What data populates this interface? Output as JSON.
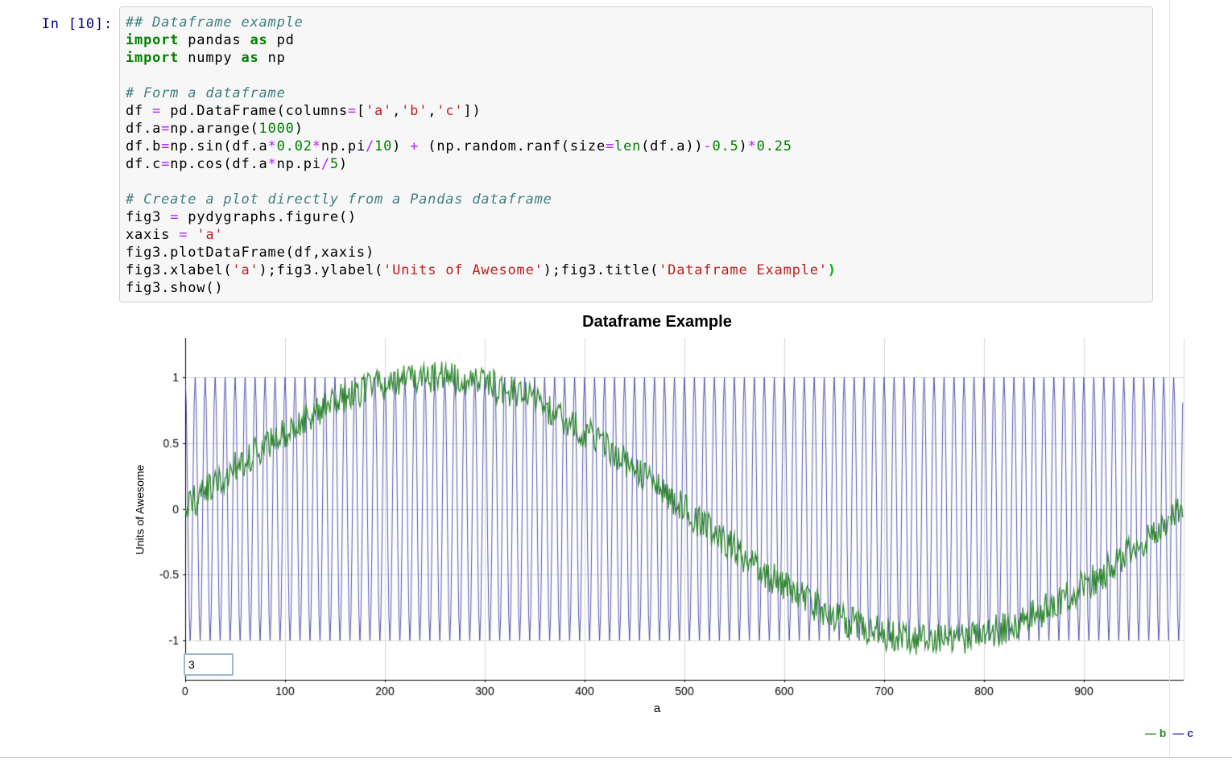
{
  "notebook": {
    "prompt": "In [10]:",
    "code_lines": [
      [
        [
          "c",
          "## Dataframe example"
        ]
      ],
      [
        [
          "k",
          "import"
        ],
        [
          "p",
          " pandas "
        ],
        [
          "k",
          "as"
        ],
        [
          "p",
          " pd"
        ]
      ],
      [
        [
          "k",
          "import"
        ],
        [
          "p",
          " numpy "
        ],
        [
          "k",
          "as"
        ],
        [
          "p",
          " np"
        ]
      ],
      [],
      [
        [
          "c",
          "# Form a dataframe"
        ]
      ],
      [
        [
          "p",
          "df "
        ],
        [
          "o",
          "="
        ],
        [
          "p",
          " pd.DataFrame(columns"
        ],
        [
          "o",
          "="
        ],
        [
          "p",
          "["
        ],
        [
          "s",
          "'a'"
        ],
        [
          "p",
          ","
        ],
        [
          "s",
          "'b'"
        ],
        [
          "p",
          ","
        ],
        [
          "s",
          "'c'"
        ],
        [
          "p",
          "])"
        ]
      ],
      [
        [
          "p",
          "df.a"
        ],
        [
          "o",
          "="
        ],
        [
          "p",
          "np.arange("
        ],
        [
          "n",
          "1000"
        ],
        [
          "p",
          ")"
        ]
      ],
      [
        [
          "p",
          "df.b"
        ],
        [
          "o",
          "="
        ],
        [
          "p",
          "np.sin(df.a"
        ],
        [
          "o",
          "*"
        ],
        [
          "n",
          "0.02"
        ],
        [
          "o",
          "*"
        ],
        [
          "p",
          "np.pi"
        ],
        [
          "o",
          "/"
        ],
        [
          "n",
          "10"
        ],
        [
          "p",
          ") "
        ],
        [
          "o",
          "+"
        ],
        [
          "p",
          " (np.random.ranf(size"
        ],
        [
          "o",
          "="
        ],
        [
          "b",
          "len"
        ],
        [
          "p",
          "(df.a))"
        ],
        [
          "o",
          "-"
        ],
        [
          "n",
          "0.5"
        ],
        [
          "p",
          ")"
        ],
        [
          "o",
          "*"
        ],
        [
          "n",
          "0.25"
        ]
      ],
      [
        [
          "p",
          "df.c"
        ],
        [
          "o",
          "="
        ],
        [
          "p",
          "np.cos(df.a"
        ],
        [
          "o",
          "*"
        ],
        [
          "p",
          "np.pi"
        ],
        [
          "o",
          "/"
        ],
        [
          "n",
          "5"
        ],
        [
          "p",
          ")"
        ]
      ],
      [],
      [
        [
          "c",
          "# Create a plot directly from a Pandas dataframe"
        ]
      ],
      [
        [
          "p",
          "fig3 "
        ],
        [
          "o",
          "="
        ],
        [
          "p",
          " pydygraphs.figure()"
        ]
      ],
      [
        [
          "p",
          "xaxis "
        ],
        [
          "o",
          "="
        ],
        [
          "p",
          " "
        ],
        [
          "s",
          "'a'"
        ]
      ],
      [
        [
          "p",
          "fig3.plotDataFrame(df,xaxis)"
        ]
      ],
      [
        [
          "p",
          "fig3.xlabel("
        ],
        [
          "s",
          "'a'"
        ],
        [
          "p",
          ");fig3.ylabel("
        ],
        [
          "s",
          "'Units of Awesome'"
        ],
        [
          "p",
          ");fig3.title("
        ],
        [
          "s",
          "'Dataframe Example'"
        ],
        [
          "m",
          ")"
        ]
      ],
      [
        [
          "p",
          "fig3.show()"
        ]
      ]
    ]
  },
  "chart_data": {
    "type": "line",
    "title": "Dataframe Example",
    "xlabel": "a",
    "ylabel": "Units of Awesome",
    "xlim": [
      0,
      1000
    ],
    "ylim": [
      -1.3,
      1.3
    ],
    "x_ticks": [
      0,
      100,
      200,
      300,
      400,
      500,
      600,
      700,
      800,
      900
    ],
    "y_ticks": [
      1,
      0.5,
      0,
      -0.5,
      -1
    ],
    "grid": true,
    "grid_color": "#d9d9d9",
    "legend_position": "bottom-right",
    "legend_entries": [
      "b",
      "c"
    ],
    "roller_value": "3",
    "series": [
      {
        "name": "b",
        "fn": "sin",
        "freq": 0.0062832,
        "noise_amp": 0.25,
        "color": "#2d862d",
        "points": 1000,
        "formula": "sin(a*0.02*pi/10) + (rand-0.5)*0.25"
      },
      {
        "name": "c",
        "fn": "cos",
        "freq": 0.6283185,
        "noise_amp": 0,
        "color": "#3333a0",
        "points": 1000,
        "formula": "cos(a*pi/5)"
      }
    ]
  }
}
